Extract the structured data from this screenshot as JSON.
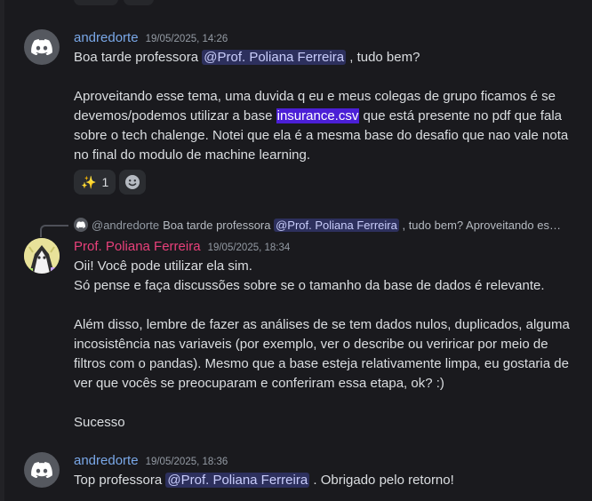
{
  "messages": [
    {
      "author": "andredorte",
      "timestamp": "19/05/2025, 14:26",
      "line1_before": "Boa tarde professora ",
      "line1_mention": "@Prof. Poliana Ferreira",
      "line1_after": " , tudo bem?",
      "para2_before": "Aproveitando esse tema, uma duvida q eu e meus colegas de grupo ficamos é se devemos/podemos utilizar a base ",
      "para2_highlight": "insurance.csv",
      "para2_after": " que está presente no pdf que fala sobre o tech chalenge. Notei que ela é a mesma base do desafio que nao vale nota no final do modulo de machine learning.",
      "reaction_emoji": "✨",
      "reaction_count": "1",
      "add_reaction_icon": "smiley-add-icon"
    },
    {
      "reply_author": "@andredorte",
      "reply_before": "Boa tarde professora ",
      "reply_mention": "@Prof. Poliana Ferreira",
      "reply_after": " , tudo bem?  Aproveitando es…",
      "author": "Prof. Poliana Ferreira",
      "timestamp": "19/05/2025, 18:34",
      "line1": "Oii! Você pode utilizar ela sim.",
      "line2": "Só pense e faça discussões sobre se o tamanho da base de dados é relevante.",
      "para3": "Além disso, lembre de fazer as análises de se tem dados nulos, duplicados, alguma incosistência nas variaveis (por exemplo, ver o describe ou veriricar por meio de filtros com o pandas). Mesmo que a base esteja relativamente limpa, eu gostaria de ver que vocês se preocuparam e conferiram essa etapa, ok? :)",
      "para4": "Sucesso"
    },
    {
      "author": "andredorte",
      "timestamp": "19/05/2025, 18:36",
      "before": "Top professora ",
      "mention": "@Prof. Poliana Ferreira",
      "after": " . Obrigado pelo retorno!"
    }
  ],
  "colors": {
    "background": "#1a1a1e",
    "author_default": "#7aa8e8",
    "author_prof": "#e8407a",
    "mention_bg": "rgba(88,101,242,0.3)",
    "highlight_bg": "#4b1fd6"
  }
}
